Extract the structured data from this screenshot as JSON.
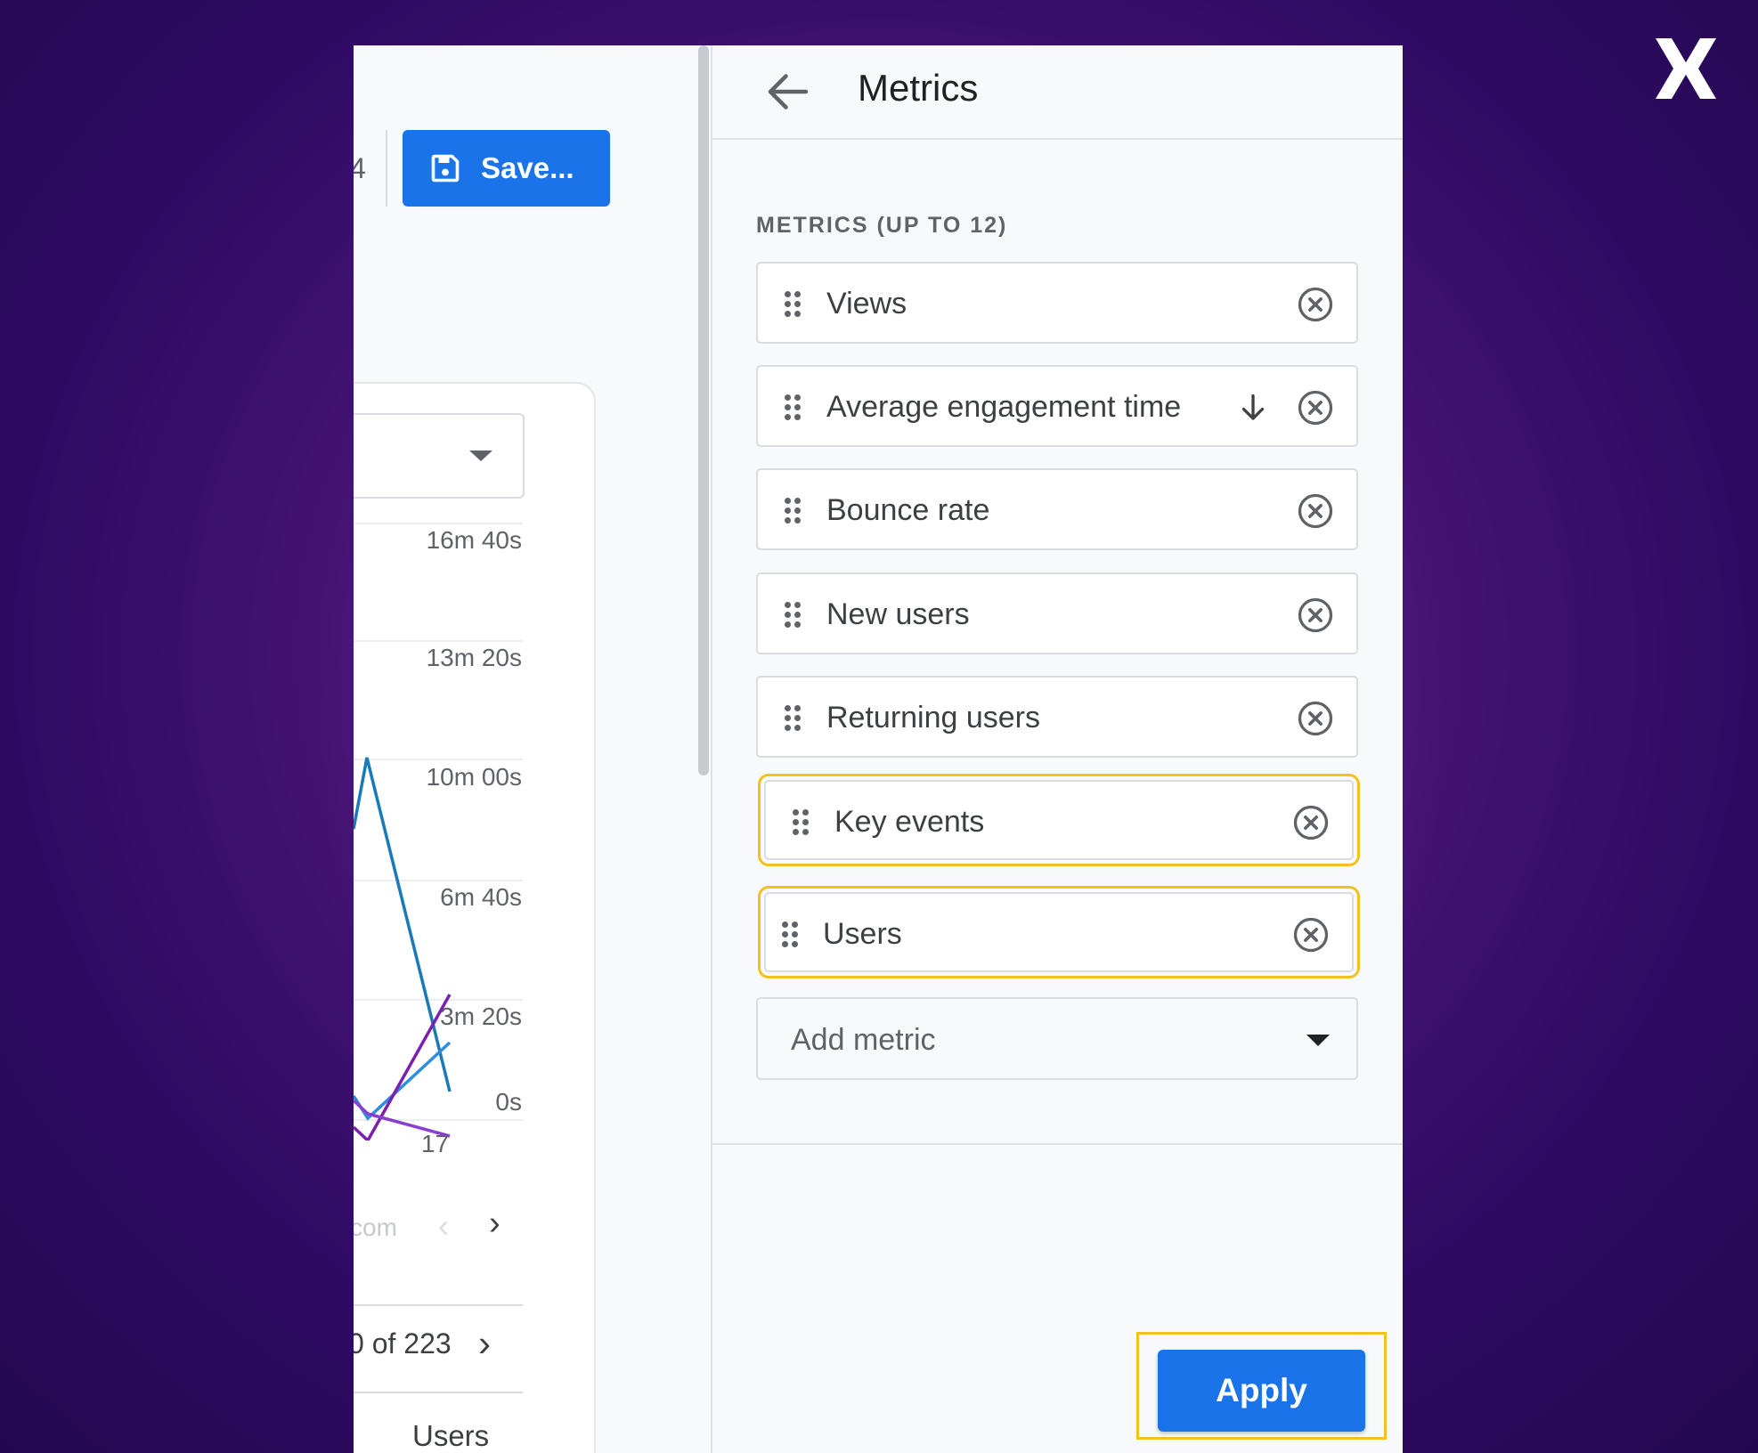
{
  "header": {
    "save_label": "Save...",
    "save_icon": "floppy-disk-icon",
    "partial_text": "4"
  },
  "brand": {
    "logo": "x-logo-icon"
  },
  "chart_data": {
    "type": "line",
    "yticks": [
      "16m 40s",
      "13m 20s",
      "10m 00s",
      "6m 40s",
      "3m 20s",
      "0s"
    ],
    "xtick": "17",
    "ylim": [
      "0s",
      "16m 40s"
    ],
    "series_colors": [
      "#1a7ab8",
      "#2f8de0",
      "#8a3fd0",
      "#7a1fb0"
    ]
  },
  "table": {
    "pager_text": "com",
    "rows_text": "0 of 223",
    "column_header": "Users"
  },
  "panel": {
    "title": "Metrics",
    "section_label": "METRICS (UP TO 12)",
    "metrics": [
      {
        "label": "Views"
      },
      {
        "label": "Average engagement time",
        "sorted": "descending"
      },
      {
        "label": "Bounce rate"
      },
      {
        "label": "New users"
      },
      {
        "label": "Returning users"
      },
      {
        "label": "Key events",
        "highlighted": true
      },
      {
        "label": "Users",
        "highlighted": true
      }
    ],
    "add_metric_placeholder": "Add metric",
    "apply_label": "Apply"
  },
  "colors": {
    "primary": "#1a73e8",
    "highlight": "#f2c11d",
    "background": "#2f0a63"
  }
}
